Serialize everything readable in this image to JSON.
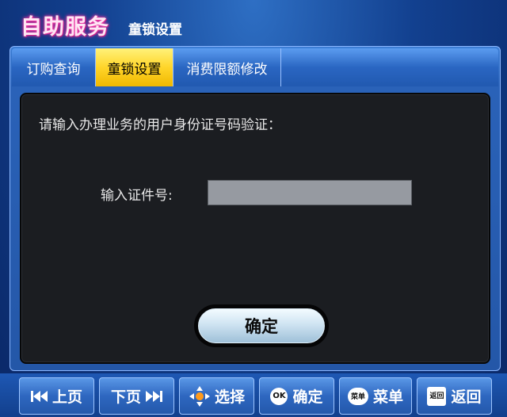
{
  "header": {
    "brand": "自助服务",
    "subtitle": "童锁设置"
  },
  "tabs": [
    {
      "label": "订购查询",
      "active": false
    },
    {
      "label": "童锁设置",
      "active": true
    },
    {
      "label": "消费限额修改",
      "active": false
    }
  ],
  "content": {
    "prompt": "请输入办理业务的用户身份证号码验证：",
    "id_label": "输入证件号:",
    "id_value": "",
    "confirm_label": "确定"
  },
  "bottom_bar": {
    "prev": "上页",
    "next": "下页",
    "select": "选择",
    "ok_icon_text": "OK",
    "ok": "确定",
    "menu_icon_text": "菜单",
    "menu": "菜单",
    "back_icon_text": "返回",
    "back": "返回"
  },
  "colors": {
    "background": "#12408f",
    "active_tab": "#ffd52a",
    "content_bg": "#1b1d21",
    "input_bg": "#969aa1",
    "brand_glow": "#e0168f"
  }
}
